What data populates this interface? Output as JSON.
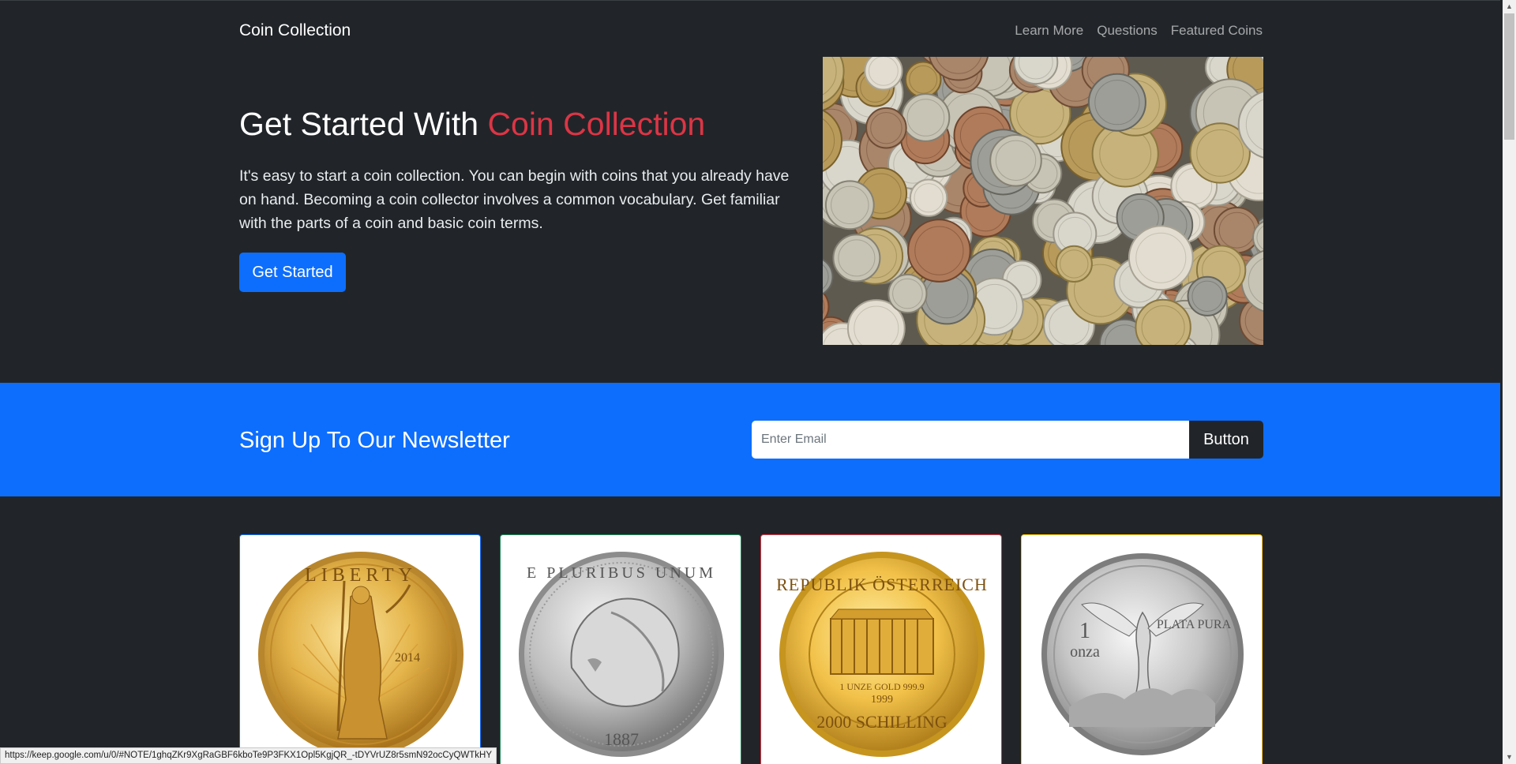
{
  "navbar": {
    "brand": "Coin Collection",
    "links": [
      "Learn More",
      "Questions",
      "Featured Coins"
    ]
  },
  "hero": {
    "title_prefix": "Get Started With ",
    "title_accent": "Coin Collection",
    "description": "It's easy to start a coin collection. You can begin with coins that you already have on hand. Becoming a coin collector involves a common vocabulary. Get familiar with the parts of a coin and basic coin terms.",
    "cta_label": "Get Started",
    "image_alt": "pile of coins"
  },
  "newsletter": {
    "title": "Sign Up To Our Newsletter",
    "email_placeholder": "Enter Email",
    "button_label": "Button"
  },
  "cards": [
    {
      "coin": "gold-eagle-coin",
      "inscription": "LIBERTY",
      "year": "2014",
      "border_color": "#0d6efd"
    },
    {
      "coin": "morgan-silver-dollar-coin",
      "inscription": "E PLURIBUS UNUM",
      "year": "1887",
      "border_color": "#198754"
    },
    {
      "coin": "vienna-philharmonic-coin",
      "inscription": "REPUBLIK ÖSTERREICH",
      "sub1": "1 UNZE GOLD 999.9",
      "sub2": "1999",
      "sub3": "2000 SCHILLING",
      "border_color": "#dc3545"
    },
    {
      "coin": "libertad-silver-coin",
      "inscription": "PLATA PURA",
      "denomination_num": "1",
      "denomination_unit": "onza",
      "border_color": "#ffc107"
    }
  ],
  "status_bar": {
    "url": "https://keep.google.com/u/0/#NOTE/1ghqZKr9XgRaGBF6kboTe9P3FKX1Opl5KgjQR_-tDYVrUZ8r5smN92ocCyQWTkHY"
  },
  "colors": {
    "dark": "#212529",
    "primary": "#0d6efd",
    "accent_red": "#dc3545",
    "success": "#198754",
    "warning": "#ffc107"
  }
}
